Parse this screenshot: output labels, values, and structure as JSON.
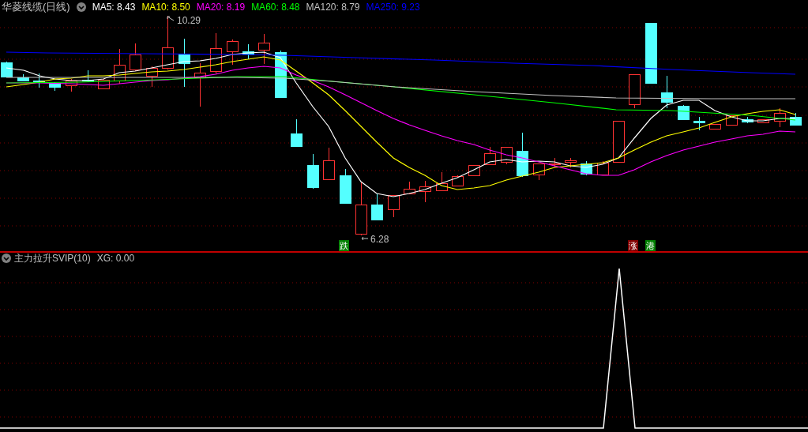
{
  "main_chart": {
    "title": "华菱线缆(日线)",
    "collapsed": false,
    "ma_legend": [
      {
        "text": "MA5: 8.43",
        "color": "#ffffff"
      },
      {
        "text": "MA10: 8.50",
        "color": "#ffff00"
      },
      {
        "text": "MA20: 8.19",
        "color": "#ff00ff"
      },
      {
        "text": "MA60: 8.48",
        "color": "#00ff00"
      },
      {
        "text": "MA120: 8.79",
        "color": "#c0c0c0"
      },
      {
        "text": "MA250: 9.23",
        "color": "#0000ff"
      }
    ],
    "high_label": "10.29",
    "low_label": "6.28",
    "signals": [
      {
        "text": "跌",
        "color": "#008000"
      },
      {
        "text": "涨",
        "color": "#800000"
      },
      {
        "text": "港",
        "color": "#008000"
      }
    ]
  },
  "indicator_panel": {
    "title": "主力拉升SVIP(10)",
    "value": "XG: 0.00",
    "collapsed": false
  }
}
